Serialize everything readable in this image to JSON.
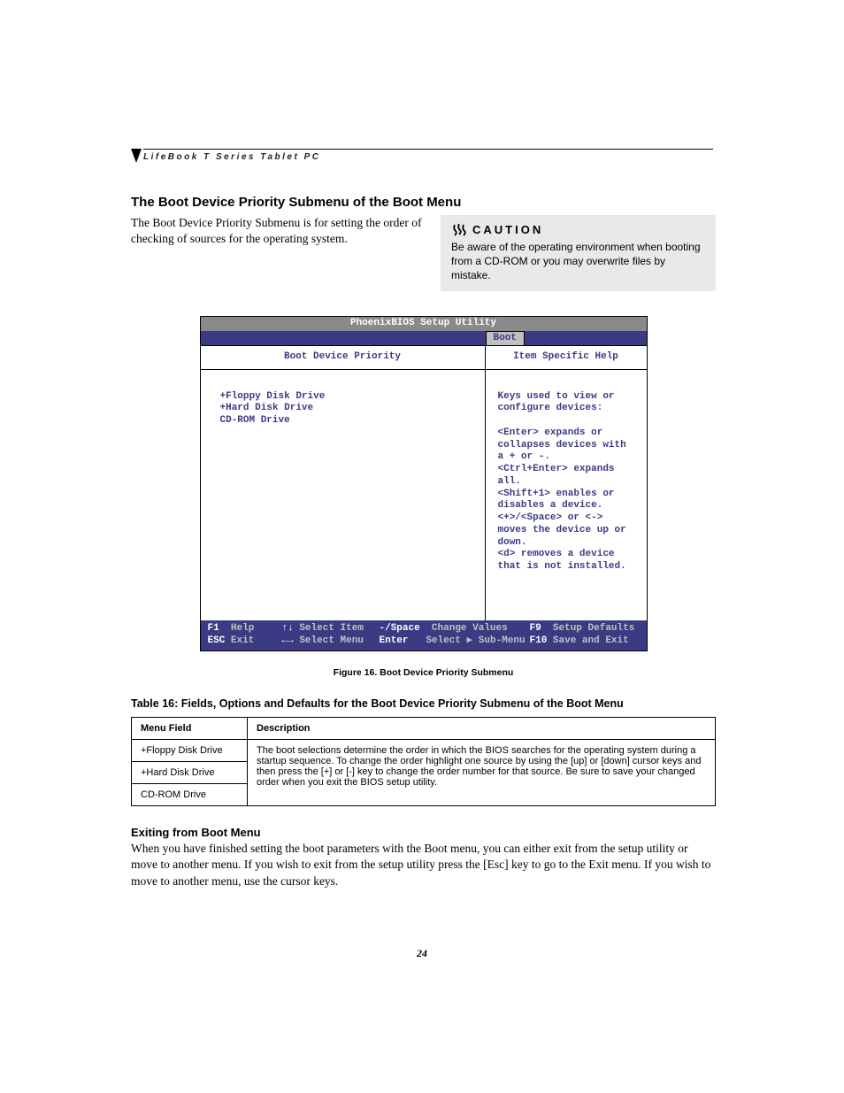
{
  "header": {
    "running": "LifeBook T Series Tablet PC"
  },
  "section": {
    "title": "The Boot Device Priority Submenu of the Boot Menu",
    "intro": "The Boot Device Priority Submenu is for setting the order of checking of sources for the operating system."
  },
  "caution": {
    "label": "CAUTION",
    "body": "Be aware of the operating environment when booting from a CD-ROM or you may overwrite files by mistake."
  },
  "bios": {
    "title": "PhoenixBIOS Setup Utility",
    "active_tab": "Boot",
    "left_title": "Boot Device Priority",
    "right_title": "Item Specific Help",
    "devices": [
      "+Floppy Disk Drive",
      "+Hard Disk Drive",
      " CD-ROM Drive"
    ],
    "help_lines": [
      "Keys used to view or",
      "configure devices:",
      "",
      "<Enter> expands or",
      "collapses devices with",
      "a + or -.",
      "<Ctrl+Enter> expands",
      "all.",
      "<Shift+1> enables or",
      "disables a device.",
      "<+>/<Space> or <->",
      "moves the device up or",
      "down.",
      "<d> removes a device",
      "that is not installed."
    ],
    "footer": {
      "r1": {
        "k1": "F1",
        "l1": "Help",
        "k2": "↑↓",
        "l2": "Select Item",
        "k3": "-/Space",
        "l3": "Change Values",
        "k4": "F9",
        "l4": "Setup Defaults"
      },
      "r2": {
        "k1": "ESC",
        "l1": "Exit",
        "k2": "←→",
        "l2": "Select Menu",
        "k3": "Enter",
        "l3": "Select ▶ Sub-Menu",
        "k4": "F10",
        "l4": "Save and Exit"
      }
    }
  },
  "figure_caption": "Figure 16.   Boot Device Priority Submenu",
  "table": {
    "title": "Table 16: Fields, Options and Defaults for the Boot Device Priority Submenu of the Boot Menu",
    "head": {
      "c1": "Menu Field",
      "c2": "Description"
    },
    "menu_fields": [
      "+Floppy Disk Drive",
      "+Hard Disk Drive",
      "CD-ROM Drive"
    ],
    "description": "The boot selections determine the order in which the BIOS searches for the operating system during a startup sequence. To change the order highlight one source by using the [up] or [down] cursor keys and then press the [+] or [-] key to change the order number for that source. Be sure to save your changed order when you exit the BIOS setup utility."
  },
  "exit": {
    "heading": "Exiting from Boot Menu",
    "body": "When you have finished setting the boot parameters with the Boot menu, you can either exit from the setup utility or move to another menu. If you wish to exit from the setup utility press the [Esc] key to go to the Exit menu. If you wish to move to another menu, use the cursor keys."
  },
  "page_number": "24"
}
